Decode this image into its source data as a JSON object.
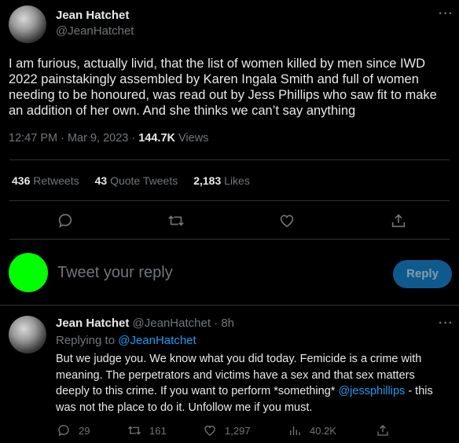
{
  "tweet": {
    "author_name": "Jean Hatchet",
    "author_handle": "@JeanHatchet",
    "more": "···",
    "text": "I am furious, actually livid, that the list of women killed by men since IWD 2022 painstakingly assembled by Karen Ingala Smith and full of women needing to be honoured, was read out by Jess Phillips who saw fit to make an addition of her own. And she thinks we can’t say anything",
    "time": "12:47 PM · Mar 9, 2023 · ",
    "views_count": "144.7K",
    "views_label": " Views"
  },
  "stats": {
    "retweets_count": "436",
    "retweets_label": "Retweets",
    "quotes_count": "43",
    "quotes_label": "Quote Tweets",
    "likes_count": "2,183",
    "likes_label": "Likes"
  },
  "actions": [
    "reply-icon",
    "retweet-icon",
    "like-icon",
    "share-icon"
  ],
  "composer": {
    "placeholder": "Tweet your reply",
    "button": "Reply",
    "avatar_color": "#00ff00"
  },
  "reply": {
    "author_name": "Jean Hatchet",
    "author_handle": "@JeanHatchet",
    "age": "· 8h",
    "more": "···",
    "replying_prefix": "Replying to ",
    "replying_to": "@JeanHatchet",
    "text_part1": "But we judge you. We know what you did today. Femicide is a crime with meaning. The perpetrators and victims have a sex and that sex matters deeply to this crime. If you want to perform *something* ",
    "mention": "@jessphillips",
    "text_part2": " - this was not the place to do it. Unfollow me if you must.",
    "replies": "29",
    "retweets": "161",
    "likes": "1,297",
    "views": "40.2K"
  },
  "colors": {
    "accent": "#1d9bf0",
    "muted": "#71767b",
    "divider": "#2f3336"
  }
}
